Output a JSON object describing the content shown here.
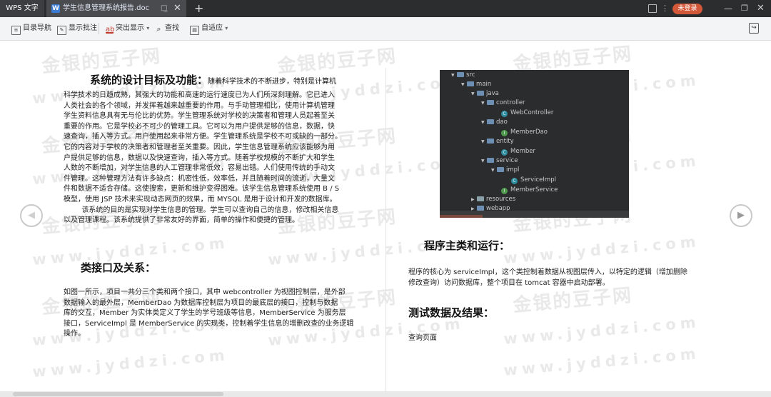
{
  "titlebar": {
    "app_name": "WPS 文字",
    "doc_icon": "W",
    "document_name": "学生信息管理系统报告.doc",
    "pin_icon": "□̲",
    "close_glyph": "✕",
    "new_tab_glyph": "+",
    "login_label": "未登录",
    "minimize_glyph": "—",
    "maximize_glyph": "❐",
    "window_close_glyph": "✕"
  },
  "toolbar": {
    "outline_label": "目录导航",
    "comments_label": "显示批注",
    "highlight_label": "突出显示",
    "find_label": "查找",
    "fit_label": "自适应",
    "dropdown_glyph": "▾",
    "exit_glyph": "↪"
  },
  "navigation": {
    "prev_glyph": "◀",
    "next_glyph": "▶"
  },
  "left_page": {
    "intro_heading": "系统的设计目标及功能：",
    "intro_first_line": "随着科学技术的不断进步，特别是计算机",
    "intro_lines": [
      "科学技术的日趋成熟，其强大的功能和高速的运行速度已为人们所深刻理解。它已进入",
      "人类社会的各个领域，并发挥着越来越重要的作用。与手动管理相比，使用计算机管理",
      "学生资料信息具有无与伦比的优势。学生管理系统对学校的决策者和管理人员起着至关",
      "重要的作用。它是学校必不可少的管理工具。它可以为用户提供足够的信息，数据，快",
      "速查询，插入等方式。用户使用起来非常方便。学生管理系统是学校不可或缺的一部分。",
      "它的内容对于学校的决策者和管理者至关重要。因此，学生信息管理系统应该能够为用",
      "户提供足够的信息，数据以及快速查询，插入等方式。随着学校规模的不断扩大和学生",
      "人数的不断增加，对学生信息的人工管理非常低效，容易出错。人们使用传统的手动文",
      "件管理。这种管理方法有许多缺点：机密性低，效率低，并且随着时间的流逝，大量文",
      "件和数据不适合存储。这使搜索，更新和维护变得困难。该学生信息管理系统使用 B / S",
      "模型，使用 JSP 技术来实现动态网页的效果，而 MYSQL 是用于设计和开发的数据库。",
      "        该系统的目的是实现对学生信息的管理。学生可以查询自己的信息，修改相关信息",
      "以及管理课程。该系统提供了非常友好的界面，简单的操作和便捷的管理。"
    ],
    "class_heading": "类接口及关系：",
    "class_lines": [
      "如图一所示，项目一共分三个类和两个接口，其中 webcontroller 为视图控制层，是外部",
      "数据输入的最外层，MemberDao 为数据库控制层为项目的最底层的接口，控制与数据",
      "库的交互，Member 为实体类定义了学生的学号班级等信息，MemberService 为服务层",
      "接口，ServiceImpl 是 MemberService 的实现类，控制着学生信息的增删改查的业务逻辑",
      "操作。"
    ]
  },
  "right_page": {
    "tree": [
      {
        "label": "src",
        "kind": "folder"
      },
      {
        "label": "main",
        "kind": "folder"
      },
      {
        "label": "java",
        "kind": "folder"
      },
      {
        "label": "controller",
        "kind": "folder"
      },
      {
        "label": "WebController",
        "kind": "class",
        "glyph": "C"
      },
      {
        "label": "dao",
        "kind": "folder"
      },
      {
        "label": "MemberDao",
        "kind": "interface",
        "glyph": "I"
      },
      {
        "label": "entity",
        "kind": "folder"
      },
      {
        "label": "Member",
        "kind": "class",
        "glyph": "C"
      },
      {
        "label": "service",
        "kind": "folder"
      },
      {
        "label": "impl",
        "kind": "folder"
      },
      {
        "label": "ServiceImpl",
        "kind": "class",
        "glyph": "C"
      },
      {
        "label": "MemberService",
        "kind": "interface",
        "glyph": "I"
      },
      {
        "label": "resources",
        "kind": "folder"
      },
      {
        "label": "webapp",
        "kind": "folder"
      }
    ],
    "run_heading": "程序主类和运行：",
    "run_lines": [
      "程序的核心为 serviceImpl，这个类控制着数据从视图层传入，以特定的逻辑（增加删除",
      "修改查询）访问数据库，整个项目在 tomcat 容器中启动部署。"
    ],
    "test_heading": "测试数据及结果：",
    "test_caption": "查询页面"
  },
  "watermark": {
    "cn": "金银的豆子网",
    "url": "www.jyddzi.com"
  }
}
